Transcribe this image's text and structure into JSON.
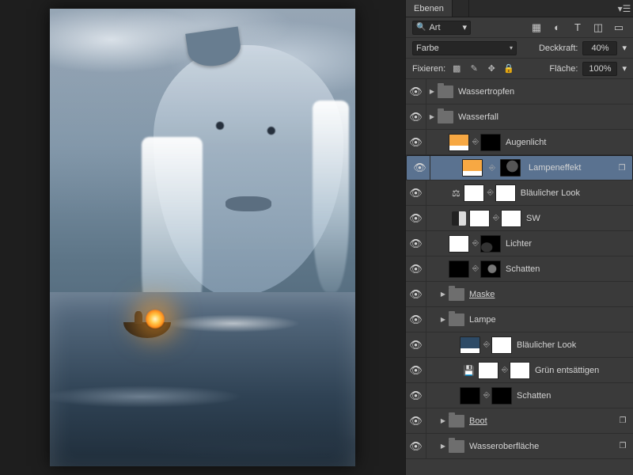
{
  "tabs": {
    "active": "Ebenen"
  },
  "filter": {
    "label": "Art"
  },
  "iconbar": [
    "image",
    "adjust",
    "text",
    "transform",
    "mask"
  ],
  "blend": {
    "mode": "Farbe",
    "opacity_label": "Deckkraft:",
    "opacity": "40%"
  },
  "lock": {
    "label": "Fixieren:",
    "fill_label": "Fläche:",
    "fill": "100%"
  },
  "layers": [
    {
      "type": "group",
      "name": "Wassertropfen",
      "indent": 0
    },
    {
      "type": "group",
      "name": "Wasserfall",
      "indent": 0
    },
    {
      "type": "adj",
      "name": "Augenlicht",
      "thumb": "gradient",
      "mask": "dark",
      "indent": 1
    },
    {
      "type": "adj",
      "name": "Lampeneffekt",
      "thumb": "gradient",
      "mask": "spot",
      "indent": 1,
      "selected": true,
      "copy": true
    },
    {
      "type": "adj",
      "name": "Bläulicher Look",
      "thumb": "white",
      "mask": "white",
      "indent": 1,
      "icon": "balance"
    },
    {
      "type": "adj",
      "name": "SW",
      "thumb": "white",
      "mask": "white",
      "indent": 1,
      "icon": "sw"
    },
    {
      "type": "adj",
      "name": "Lichter",
      "thumb": "white",
      "mask": "fx",
      "indent": 1
    },
    {
      "type": "adj",
      "name": "Schatten",
      "thumb": "black",
      "mask": "spot2",
      "indent": 1
    },
    {
      "type": "group",
      "name": "Maske",
      "indent": 1,
      "underline": true
    },
    {
      "type": "group",
      "name": "Lampe",
      "indent": 1
    },
    {
      "type": "adj",
      "name": "Bläulicher Look",
      "thumb": "navy",
      "mask": "white",
      "indent": 2
    },
    {
      "type": "adj",
      "name": "Grün entsättigen",
      "thumb": "white",
      "mask": "white",
      "indent": 2,
      "icon": "save"
    },
    {
      "type": "adj",
      "name": "Schatten",
      "thumb": "black",
      "mask": "dark",
      "indent": 2
    },
    {
      "type": "group",
      "name": "Boot",
      "indent": 1,
      "underline": true,
      "copy": true
    },
    {
      "type": "group",
      "name": "Wasseroberfläche",
      "indent": 1,
      "copy": true
    }
  ]
}
